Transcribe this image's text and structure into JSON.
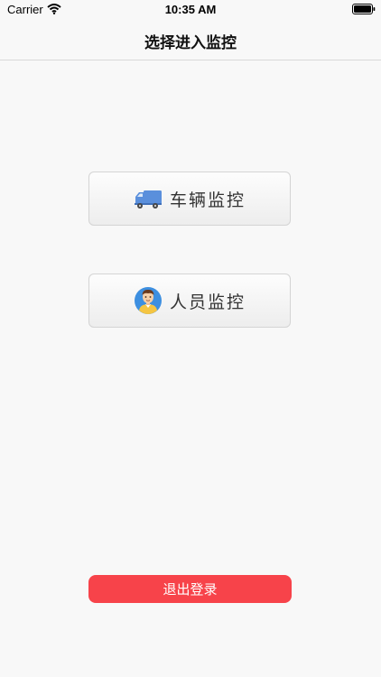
{
  "status_bar": {
    "carrier": "Carrier",
    "time": "10:35 AM"
  },
  "nav": {
    "title": "选择进入监控"
  },
  "menu": {
    "vehicle_label": "车辆监控",
    "personnel_label": "人员监控"
  },
  "logout": {
    "label": "退出登录",
    "color": "#f7434a"
  },
  "icons": {
    "vehicle": "truck-icon",
    "personnel": "person-avatar-icon"
  }
}
